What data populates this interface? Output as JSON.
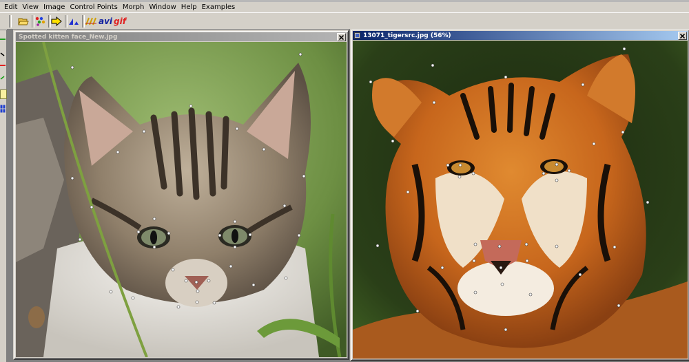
{
  "menu": [
    "Edit",
    "View",
    "Image",
    "Control Points",
    "Morph",
    "Window",
    "Help",
    "Examples"
  ],
  "toolbar": {
    "avi_label": "avi",
    "gif_label": "gif"
  },
  "windows": {
    "left": {
      "title": "Spotted kitten face_New.jpg",
      "close_glyph": "×"
    },
    "right": {
      "title": "13071_tigersrc.jpg (56%)",
      "close_glyph": "×"
    }
  },
  "colors": {
    "active_title": "#0a246a",
    "inactive_title": "#808080",
    "control_point": "#ffffff"
  },
  "control_points": {
    "kitten": 34,
    "tiger": 36
  }
}
